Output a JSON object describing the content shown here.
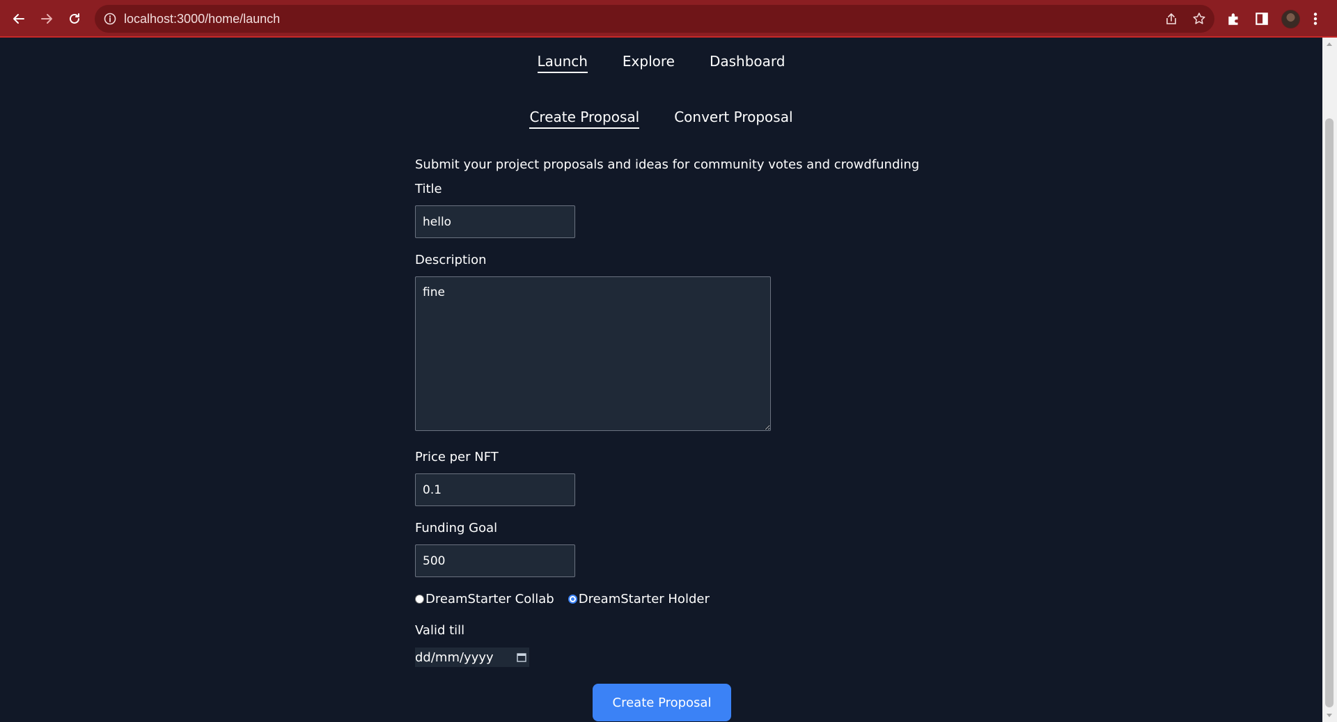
{
  "browser": {
    "url": "localhost:3000/home/launch"
  },
  "nav": {
    "items": [
      {
        "label": "Launch",
        "active": true
      },
      {
        "label": "Explore",
        "active": false
      },
      {
        "label": "Dashboard",
        "active": false
      }
    ]
  },
  "subnav": {
    "items": [
      {
        "label": "Create Proposal",
        "active": true
      },
      {
        "label": "Convert Proposal",
        "active": false
      }
    ]
  },
  "form": {
    "intro": "Submit your project proposals and ideas for community votes and crowdfunding",
    "title_label": "Title",
    "title_value": "hello",
    "description_label": "Description",
    "description_value": "fine",
    "price_label": "Price per NFT",
    "price_value": "0.1",
    "goal_label": "Funding Goal",
    "goal_value": "500",
    "radio_collab": "DreamStarter Collab",
    "radio_holder": "DreamStarter Holder",
    "radio_selected": "DreamStarter Holder",
    "valid_label": "Valid till",
    "date_placeholder": "dd/mm/yyyy",
    "submit_label": "Create Proposal"
  },
  "colors": {
    "background": "#111827",
    "accent": "#3b82f6",
    "browser_bar": "#8b1e22"
  }
}
